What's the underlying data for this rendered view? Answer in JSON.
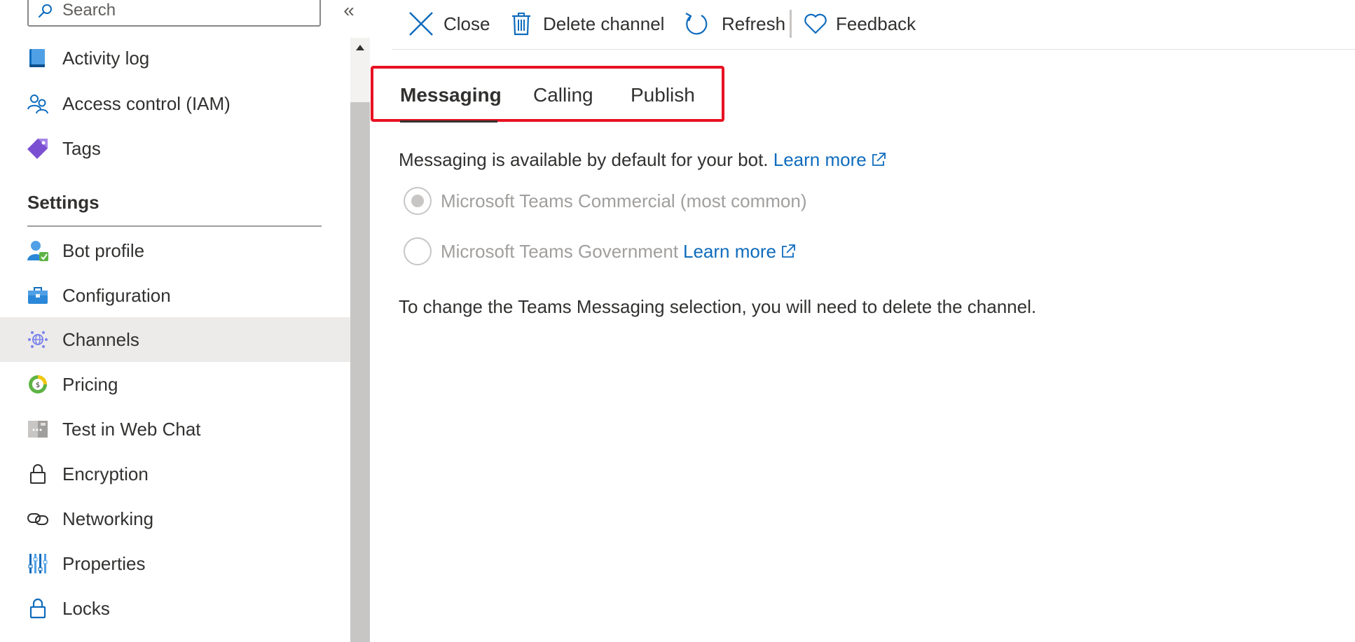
{
  "sidebar": {
    "search": {
      "placeholder": "Search",
      "value": ""
    },
    "collapse_glyph": "«",
    "top_items": [
      {
        "label": "Activity log",
        "icon": "activity-log-icon"
      },
      {
        "label": "Access control (IAM)",
        "icon": "people-icon"
      },
      {
        "label": "Tags",
        "icon": "tag-icon"
      }
    ],
    "section_header": "Settings",
    "settings_items": [
      {
        "label": "Bot profile",
        "icon": "bot-profile-icon",
        "selected": false
      },
      {
        "label": "Configuration",
        "icon": "toolbox-icon",
        "selected": false
      },
      {
        "label": "Channels",
        "icon": "channels-icon",
        "selected": true
      },
      {
        "label": "Pricing",
        "icon": "pricing-icon",
        "selected": false
      },
      {
        "label": "Test in Web Chat",
        "icon": "web-chat-icon",
        "selected": false
      },
      {
        "label": "Encryption",
        "icon": "lock-icon",
        "selected": false
      },
      {
        "label": "Networking",
        "icon": "link-icon",
        "selected": false
      },
      {
        "label": "Properties",
        "icon": "properties-icon",
        "selected": false
      },
      {
        "label": "Locks",
        "icon": "lock-blue-icon",
        "selected": false
      }
    ]
  },
  "toolbar": {
    "close_label": "Close",
    "delete_label": "Delete channel",
    "refresh_label": "Refresh",
    "feedback_label": "Feedback"
  },
  "tabs": [
    {
      "label": "Messaging",
      "active": true
    },
    {
      "label": "Calling",
      "active": false
    },
    {
      "label": "Publish",
      "active": false
    }
  ],
  "content": {
    "info_text": "Messaging is available by default for your bot.",
    "info_link": "Learn more",
    "radio_options": [
      {
        "label": "Microsoft Teams Commercial (most common)",
        "checked": true,
        "link": ""
      },
      {
        "label": "Microsoft Teams Government",
        "checked": false,
        "link": "Learn more"
      }
    ],
    "note": "To change the Teams Messaging selection, you will need to delete the channel."
  },
  "colors": {
    "accent": "#0f6cbd",
    "highlight_border": "#e81123",
    "selected_nav_bg": "#edebe9",
    "disabled_text": "#a19f9d"
  }
}
